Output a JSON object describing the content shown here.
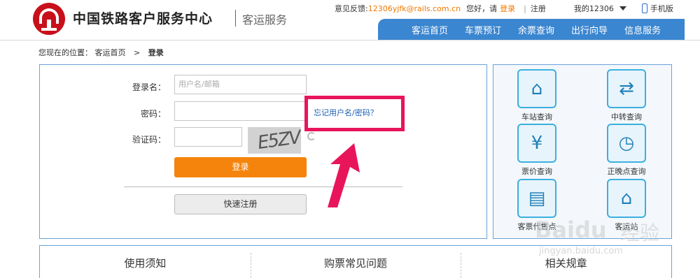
{
  "header": {
    "site_name": "中国铁路客户服务中心",
    "site_sub": "客运服务",
    "feedback_label": "意见反馈:",
    "feedback_email": "12306yjfk@rails.com.cn",
    "greeting": "您好，请",
    "login_link": "登录",
    "separator": "|",
    "register_link": "注册",
    "my_account": "我的12306",
    "mobile": "手机版"
  },
  "nav": {
    "items": [
      {
        "label": "客运首页"
      },
      {
        "label": "车票预订"
      },
      {
        "label": "余票查询"
      },
      {
        "label": "出行向导"
      },
      {
        "label": "信息服务"
      }
    ]
  },
  "breadcrumb": {
    "prefix": "您现在的位置：",
    "home": "客运首页",
    "gt": ">",
    "current": "登录"
  },
  "login": {
    "username_label": "登录名：",
    "username_placeholder": "用户名/邮箱",
    "password_label": "密码：",
    "captcha_label": "验证码：",
    "captcha_text": "E5ZV",
    "login_button": "登录",
    "register_button": "快速注册",
    "forgot_link": "忘记用户名/密码？"
  },
  "services": {
    "items": [
      {
        "label": "车站查询",
        "icon": "station-icon"
      },
      {
        "label": "中转查询",
        "icon": "transfer-icon"
      },
      {
        "label": "票价查询",
        "icon": "price-search-icon"
      },
      {
        "label": "正晚点查询",
        "icon": "clock-icon"
      },
      {
        "label": "客票代售点",
        "icon": "ticket-agency-icon"
      },
      {
        "label": "客运站",
        "icon": "passenger-station-icon"
      }
    ]
  },
  "bottom_tabs": [
    {
      "label": "使用须知"
    },
    {
      "label": "购票常见问题"
    },
    {
      "label": "相关规章"
    }
  ],
  "watermark": {
    "brand": "Baidu",
    "suffix": "经验",
    "url": "jingyan.baidu.com"
  },
  "colors": {
    "accent_blue": "#3b86d0",
    "login_orange": "#f5840c",
    "highlight_pink": "#e8155b",
    "logo_red": "#c8101a"
  }
}
